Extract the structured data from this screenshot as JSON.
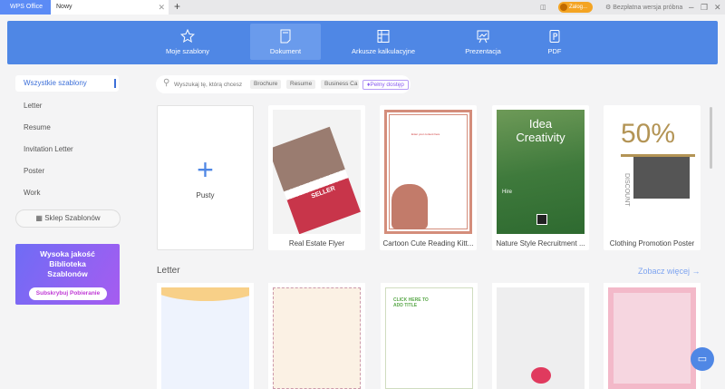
{
  "tabs": {
    "app": "WPS Office",
    "current": "Nowy"
  },
  "titlebar": {
    "login": "Zalog...",
    "trial": "Bezpłatna wersja próbna"
  },
  "categories": [
    {
      "label": "Moje szablony",
      "icon": "star-icon"
    },
    {
      "label": "Dokument",
      "icon": "document-icon"
    },
    {
      "label": "Arkusze kalkulacyjne",
      "icon": "spreadsheet-icon"
    },
    {
      "label": "Prezentacja",
      "icon": "presentation-icon"
    },
    {
      "label": "PDF",
      "icon": "pdf-icon"
    }
  ],
  "sidebar": {
    "items": [
      "Wszystkie szablony",
      "Letter",
      "Resume",
      "Invitation Letter",
      "Poster",
      "Work"
    ],
    "shop": "Sklep Szablonów",
    "promo": {
      "line1": "Wysoka jakość",
      "line2": "Biblioteka",
      "line3": "Szablonów",
      "button": "Subskrybuj Pobieranie"
    }
  },
  "search": {
    "placeholder": "Wyszukaj tę, którą chcesz",
    "chips": [
      "Brochure",
      "Resume",
      "Business Ca"
    ],
    "premium": "Pełny dostęp"
  },
  "templates": [
    {
      "label": "Pusty"
    },
    {
      "label": "Real Estate Flyer",
      "thumb_text": "SELLER"
    },
    {
      "label": "Cartoon Cute Reading Kitt...",
      "thumb_text": "Enter your content here"
    },
    {
      "label": "Nature Style Recruitment ...",
      "thumb_text": "Idea Creativity",
      "thumb_sub": "Hire"
    },
    {
      "label": "Clothing Promotion Poster",
      "thumb_text": "50%",
      "thumb_sub": "DISCOUNT"
    }
  ],
  "letter_section": {
    "title": "Letter",
    "more": "Zobacz więcej",
    "thumb_title": "CLICK HERE TO ADD TITLE"
  }
}
